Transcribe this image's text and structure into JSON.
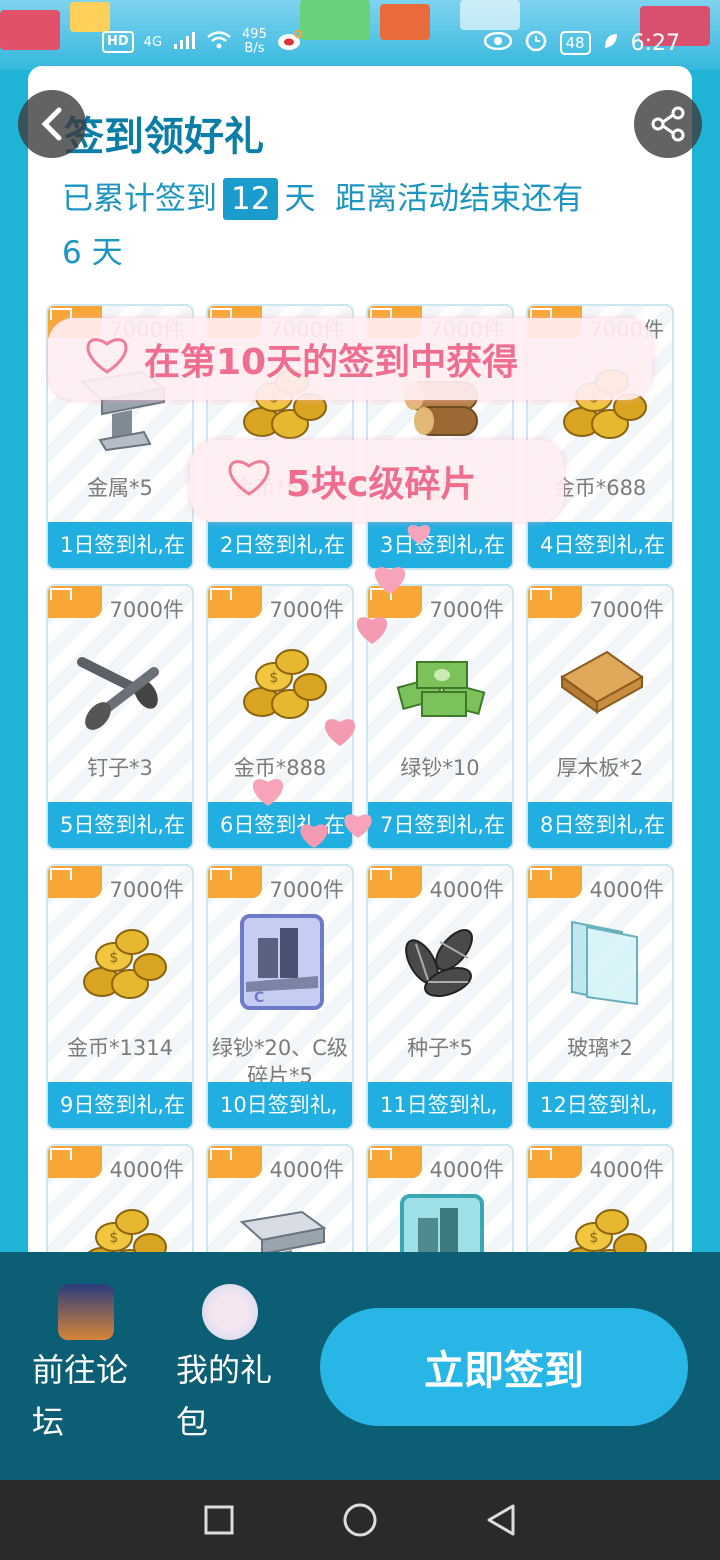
{
  "status_bar": {
    "hd": "HD",
    "network": "4G",
    "speed_value": "495",
    "speed_unit": "B/s",
    "battery": "48",
    "time": "6:27"
  },
  "header": {
    "title": "签到领好礼",
    "signed_prefix": "已累计签到",
    "signed_days": "12",
    "signed_suffix": "天",
    "remain_prefix": "距离活动结束还有",
    "remain_days": "6",
    "remain_suffix": "天"
  },
  "cards": [
    {
      "stock": "7000件",
      "name": "金属*5",
      "day": "1日签到礼,在",
      "icon": "metal"
    },
    {
      "stock": "7000件",
      "name": "金币*500",
      "day": "2日签到礼,在",
      "icon": "coins"
    },
    {
      "stock": "7000件",
      "name": "木材*2",
      "day": "3日签到礼,在",
      "icon": "wood"
    },
    {
      "stock": "7000件",
      "name": "金币*688",
      "day": "4日签到礼,在",
      "icon": "coins"
    },
    {
      "stock": "7000件",
      "name": "钉子*3",
      "day": "5日签到礼,在",
      "icon": "nails"
    },
    {
      "stock": "7000件",
      "name": "金币*888",
      "day": "6日签到礼,在",
      "icon": "coins"
    },
    {
      "stock": "7000件",
      "name": "绿钞*10",
      "day": "7日签到礼,在",
      "icon": "cash"
    },
    {
      "stock": "7000件",
      "name": "厚木板*2",
      "day": "8日签到礼,在",
      "icon": "planks"
    },
    {
      "stock": "7000件",
      "name": "金币*1314",
      "day": "9日签到礼,在",
      "icon": "coins"
    },
    {
      "stock": "7000件",
      "name": "绿钞*20、C级碎片*5",
      "day": "10日签到礼,",
      "icon": "cardC"
    },
    {
      "stock": "4000件",
      "name": "种子*5",
      "day": "11日签到礼,",
      "icon": "seeds"
    },
    {
      "stock": "4000件",
      "name": "玻璃*2",
      "day": "12日签到礼,",
      "icon": "glass"
    },
    {
      "stock": "4000件",
      "name": "",
      "day": "",
      "icon": "coins"
    },
    {
      "stock": "4000件",
      "name": "",
      "day": "",
      "icon": "metal"
    },
    {
      "stock": "4000件",
      "name": "",
      "day": "",
      "icon": "cardB"
    },
    {
      "stock": "4000件",
      "name": "",
      "day": "",
      "icon": "coins"
    }
  ],
  "overlay": {
    "line1": "在第10天的签到中获得",
    "line2": "5块c级碎片"
  },
  "bottom": {
    "forum_label": "前往论坛",
    "gift_label": "我的礼包",
    "sign_button": "立即签到"
  },
  "colors": {
    "accent": "#21aee0",
    "tag": "#f8a737",
    "bottom_bg": "#0c5e74",
    "title": "#0a7ea6"
  }
}
